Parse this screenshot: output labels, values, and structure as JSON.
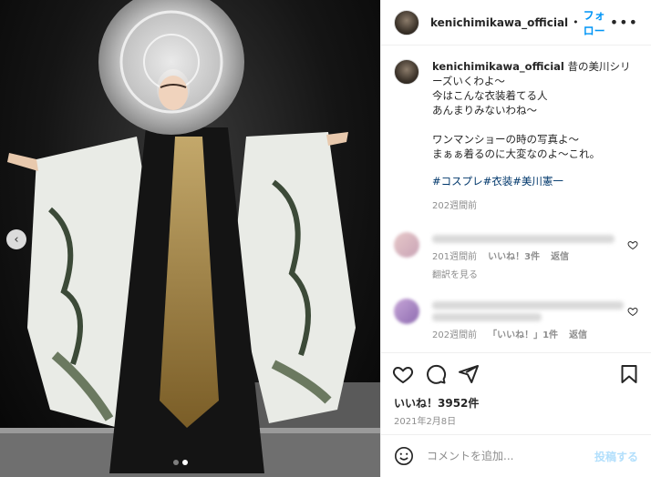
{
  "post": {
    "username": "kenichimikawa_official",
    "separator": "•",
    "follow_label": "フォロー",
    "more_icon": "more-horizontal-icon",
    "caption_text": "昔の美川シリーズいくわよ〜\n今はこんな衣装着てる人\nあんまりみないわね〜\n\nワンマンショーの時の写真よ〜\nまぁぁ着るのに大変なのよ〜これ。",
    "hashtags": [
      "#コスプレ",
      "#衣装",
      "#美川憲一"
    ],
    "caption_time": "202週間前",
    "likes": "いいね！3952件",
    "date": "2021年2月8日"
  },
  "comments": [
    {
      "time": "201週間前",
      "likes": "いいね！3件",
      "reply": "返信",
      "translate": "翻訳を見る"
    },
    {
      "time": "202週間前",
      "likes": "「いいね！」1件",
      "reply": "返信"
    }
  ],
  "actions": {
    "icons": [
      "heart-icon",
      "comment-icon",
      "share-icon",
      "bookmark-icon"
    ]
  },
  "add_comment": {
    "placeholder": "コメントを追加...",
    "post_label": "投稿する",
    "emoji_icon": "emoji-icon"
  },
  "colors": {
    "link_blue": "#0095f6",
    "hashtag": "#00376b",
    "muted": "#8e8e8e",
    "post_disabled": "#b2dffc"
  }
}
